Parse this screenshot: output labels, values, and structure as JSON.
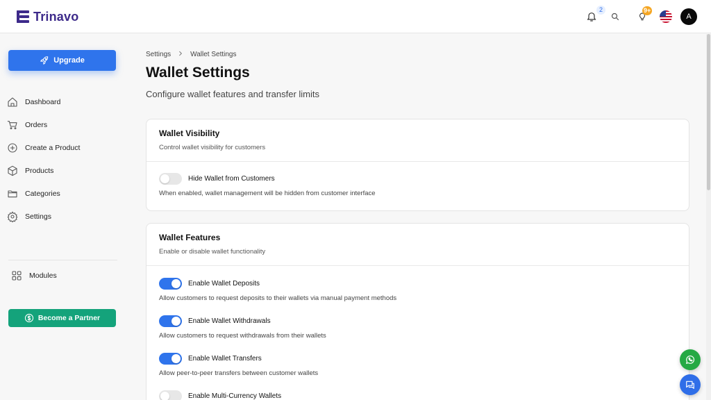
{
  "app": {
    "name": "Trinavo",
    "logo_icon": "trinavo-logo-icon"
  },
  "header": {
    "notifications": {
      "icon": "bell-icon",
      "count": "2"
    },
    "search": {
      "icon": "search-icon"
    },
    "ideas": {
      "icon": "lightbulb-icon",
      "count": "9+"
    },
    "language": {
      "icon": "us-flag-icon"
    },
    "user": {
      "avatar_initial": "A"
    }
  },
  "sidebar": {
    "upgrade_label": "Upgrade",
    "items": [
      {
        "label": "Dashboard",
        "icon": "home-icon"
      },
      {
        "label": "Orders",
        "icon": "cart-icon"
      },
      {
        "label": "Create a Product",
        "icon": "plus-circle-icon"
      },
      {
        "label": "Products",
        "icon": "box-icon"
      },
      {
        "label": "Categories",
        "icon": "folder-icon"
      },
      {
        "label": "Settings",
        "icon": "gear-icon"
      }
    ],
    "modules_label": "Modules",
    "partner_label": "Become a Partner"
  },
  "breadcrumb": {
    "root": "Settings",
    "current": "Wallet Settings"
  },
  "page": {
    "title": "Wallet Settings",
    "subtitle": "Configure wallet features and transfer limits"
  },
  "visibility_card": {
    "title": "Wallet Visibility",
    "description": "Control wallet visibility for customers",
    "options": [
      {
        "label": "Hide Wallet from Customers",
        "description": "When enabled, wallet management will be hidden from customer interface",
        "enabled": false
      }
    ]
  },
  "features_card": {
    "title": "Wallet Features",
    "description": "Enable or disable wallet functionality",
    "options": [
      {
        "label": "Enable Wallet Deposits",
        "description": "Allow customers to request deposits to their wallets via manual payment methods",
        "enabled": true
      },
      {
        "label": "Enable Wallet Withdrawals",
        "description": "Allow customers to request withdrawals from their wallets",
        "enabled": true
      },
      {
        "label": "Enable Wallet Transfers",
        "description": "Allow peer-to-peer transfers between customer wallets",
        "enabled": true
      },
      {
        "label": "Enable Multi-Currency Wallets",
        "description": "",
        "enabled": false
      }
    ]
  },
  "colors": {
    "primary": "#2f74ec",
    "brand": "#3d2a8a",
    "partner": "#14a37b",
    "whatsapp": "#25a944",
    "chat": "#2f6ee8"
  },
  "floating": {
    "whatsapp_icon": "whatsapp-icon",
    "chat_icon": "chat-icon"
  }
}
